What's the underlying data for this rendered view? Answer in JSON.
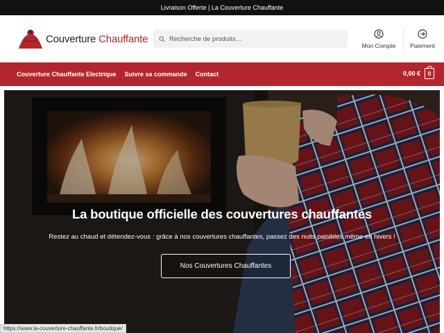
{
  "topbar": {
    "text": "Livraison Offerte | La Couverture Chauffante"
  },
  "logo": {
    "part1": "Couverture ",
    "part2": "Chauffante"
  },
  "search": {
    "placeholder": "Recherche de produits…"
  },
  "header": {
    "account_label": "Mon Compte",
    "payment_label": "Paiement"
  },
  "nav": {
    "items": [
      "Couverture Chauffante Electrique",
      "Suivre sa commande",
      "Contact"
    ],
    "cart_total": "0,00 €",
    "cart_count": "0"
  },
  "hero": {
    "title": "La boutique officielle des couvertures chauffantes",
    "subtitle": "Restez au chaud et détendez-vous : grâce à nos couvertures chauffantes, passez des nuits paisibles même en hivers !",
    "button_label": "Nos Couvertures Chauffantes"
  },
  "status": {
    "url": "https://www.la-couverture-chauffante.fr/boutique/"
  },
  "colors": {
    "brand": "#b3262d",
    "topbar": "#111111"
  },
  "icons": [
    "search-icon",
    "user-icon",
    "arrow-right-circle-icon",
    "cart-icon"
  ]
}
